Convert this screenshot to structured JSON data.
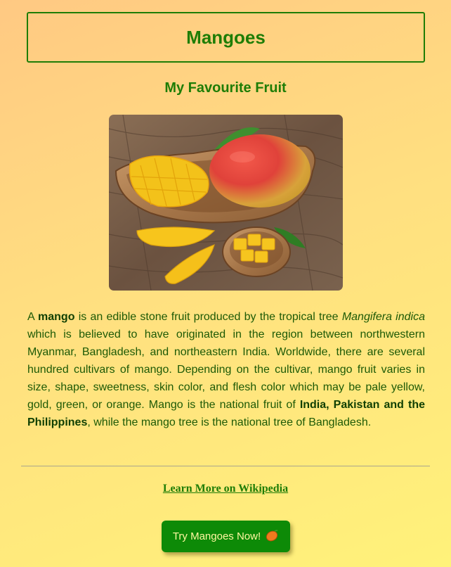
{
  "header": {
    "title": "Mangoes"
  },
  "subtitle": "My Favourite Fruit",
  "image": {
    "icon": "mango-photo"
  },
  "description": {
    "p1": "A ",
    "mango": "mango",
    "p2": " is an edible stone fruit produced by the tropical tree ",
    "species": "Mangifera indica",
    "p3": " which is believed to have originated in the region between northwestern Myanmar, Bangladesh, and northeastern India. Worldwide, there are several hundred cultivars of mango. Depending on the cultivar, mango fruit varies in size, shape, sweetness, skin color, and flesh color which may be pale yellow, gold, green, or orange. Mango is the national fruit of ",
    "countries": "India, Pakistan and the Philippines",
    "p4": ", while the mango tree is the national tree of Bangladesh."
  },
  "link": {
    "label": "Learn More on Wikipedia"
  },
  "cta": {
    "label": "Try Mangoes Now!",
    "icon": "mango-emoji-icon"
  },
  "colors": {
    "accent": "#1e7d06",
    "button": "#0d8a07",
    "button_text": "#fff7a0",
    "background_start": "#ffc983",
    "background_end": "#fff27a"
  }
}
